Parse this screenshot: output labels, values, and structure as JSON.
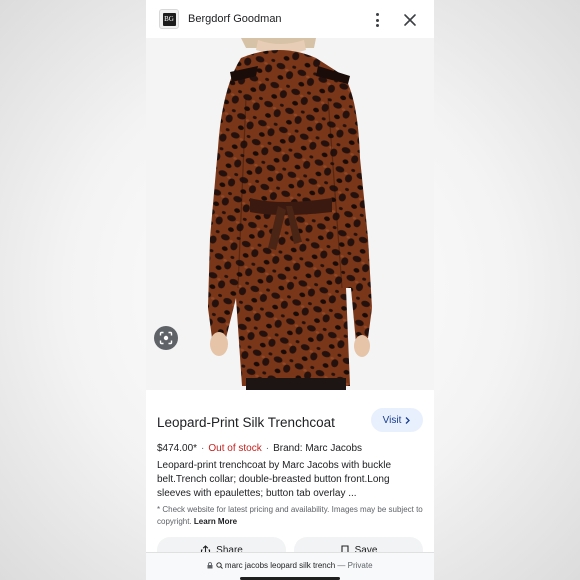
{
  "header": {
    "logo_text": "BG",
    "site_name": "Bergdorf Goodman"
  },
  "product": {
    "title": "Leopard-Print Silk Trenchcoat",
    "visit_label": "Visit",
    "price": "$474.00*",
    "stock_status": "Out of stock",
    "brand": "Brand: Marc Jacobs",
    "description": "Leopard-print trenchcoat by Marc Jacobs with buckle belt.Trench collar; double-breasted button front.Long sleeves with epaulettes; button tab overlay ...",
    "disclaimer": "* Check website for latest pricing and availability. Images may be subject to copyright.",
    "learn_more": "Learn More"
  },
  "actions": {
    "share_label": "Share",
    "save_label": "Save"
  },
  "address_bar": {
    "query": "marc jacobs leopard silk trench",
    "suffix": "— Private"
  },
  "icons": {
    "more": "more-vert-icon",
    "close": "close-icon",
    "lens": "lens-icon",
    "share": "share-icon",
    "save": "bookmark-icon",
    "lock": "lock-icon",
    "search": "search-icon"
  },
  "colors": {
    "out_of_stock": "#c5221f",
    "visit_bg": "#e8f0fe",
    "visit_text": "#1a3d8f"
  }
}
